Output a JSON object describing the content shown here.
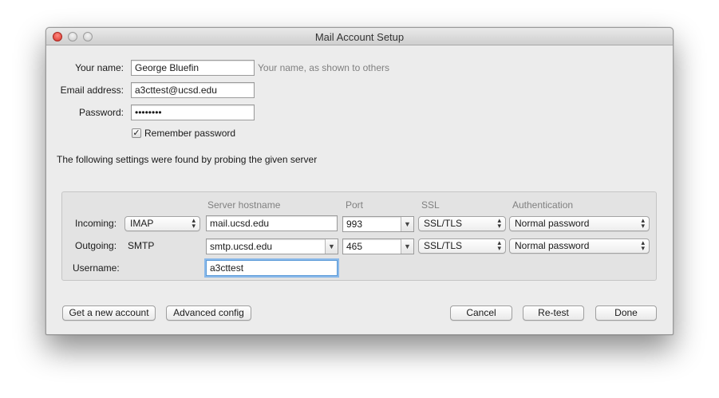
{
  "window": {
    "title": "Mail Account Setup"
  },
  "identity": {
    "name_label": "Your name:",
    "name_value": "George Bluefin",
    "name_hint": "Your name, as shown to others",
    "email_label": "Email address:",
    "email_value": "a3cttest@ucsd.edu",
    "password_label": "Password:",
    "password_value": "••••••••",
    "remember_label": "Remember password",
    "remember_checked": "✓"
  },
  "status_message": "The following settings were found by probing the given server",
  "server_settings": {
    "headers": {
      "hostname": "Server hostname",
      "port": "Port",
      "ssl": "SSL",
      "auth": "Authentication"
    },
    "incoming": {
      "label": "Incoming:",
      "protocol": "IMAP",
      "hostname": "mail.ucsd.edu",
      "port": "993",
      "ssl": "SSL/TLS",
      "auth": "Normal password"
    },
    "outgoing": {
      "label": "Outgoing:",
      "protocol": "SMTP",
      "hostname": "smtp.ucsd.edu",
      "port": "465",
      "ssl": "SSL/TLS",
      "auth": "Normal password"
    },
    "username": {
      "label": "Username:",
      "value": "a3cttest"
    }
  },
  "buttons": {
    "new_account": "Get a new account",
    "advanced": "Advanced config",
    "cancel": "Cancel",
    "retest": "Re-test",
    "done": "Done"
  },
  "icons": {
    "popup_arrows": "updown-chevron-icon",
    "combo_arrow": "chevron-down-icon"
  }
}
